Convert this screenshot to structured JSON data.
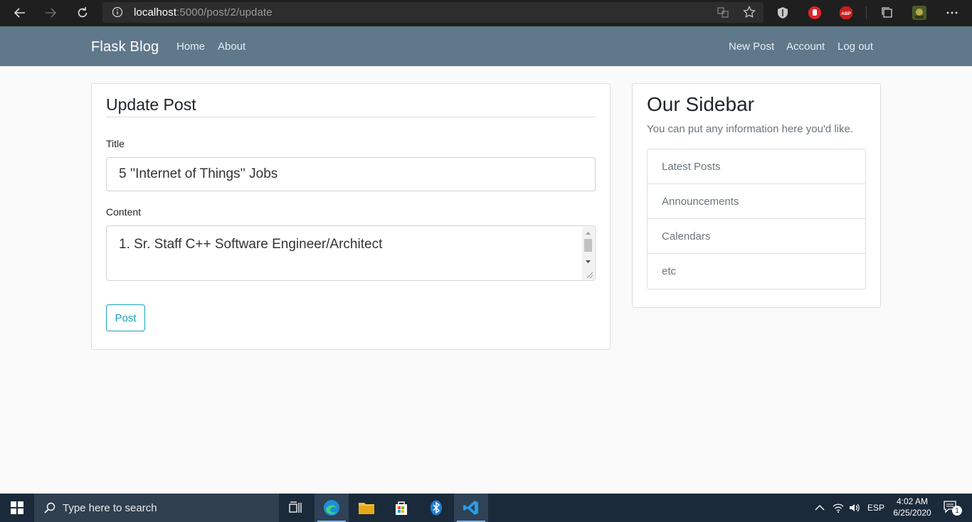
{
  "browser": {
    "url_host": "localhost",
    "url_port": ":5000",
    "url_path": "/post/2/update"
  },
  "navbar": {
    "brand": "Flask Blog",
    "left_links": [
      "Home",
      "About"
    ],
    "right_links": [
      "New Post",
      "Account",
      "Log out"
    ]
  },
  "form": {
    "legend": "Update Post",
    "title_label": "Title",
    "title_value": "5 ''Internet of Things'' Jobs",
    "content_label": "Content",
    "content_value": "1. Sr. Staff C++ Software Engineer/Architect",
    "submit_label": "Post"
  },
  "sidebar": {
    "title": "Our Sidebar",
    "text": "You can put any information here you'd like.",
    "items": [
      "Latest Posts",
      "Announcements",
      "Calendars",
      "etc"
    ]
  },
  "taskbar": {
    "search_placeholder": "Type here to search",
    "language": "ESP",
    "time": "4:02 AM",
    "date": "6/25/2020",
    "notification_count": "1"
  },
  "colors": {
    "navbar": "#5f788a",
    "accent": "#17a2b8",
    "taskbar": "#1b2a3a"
  }
}
